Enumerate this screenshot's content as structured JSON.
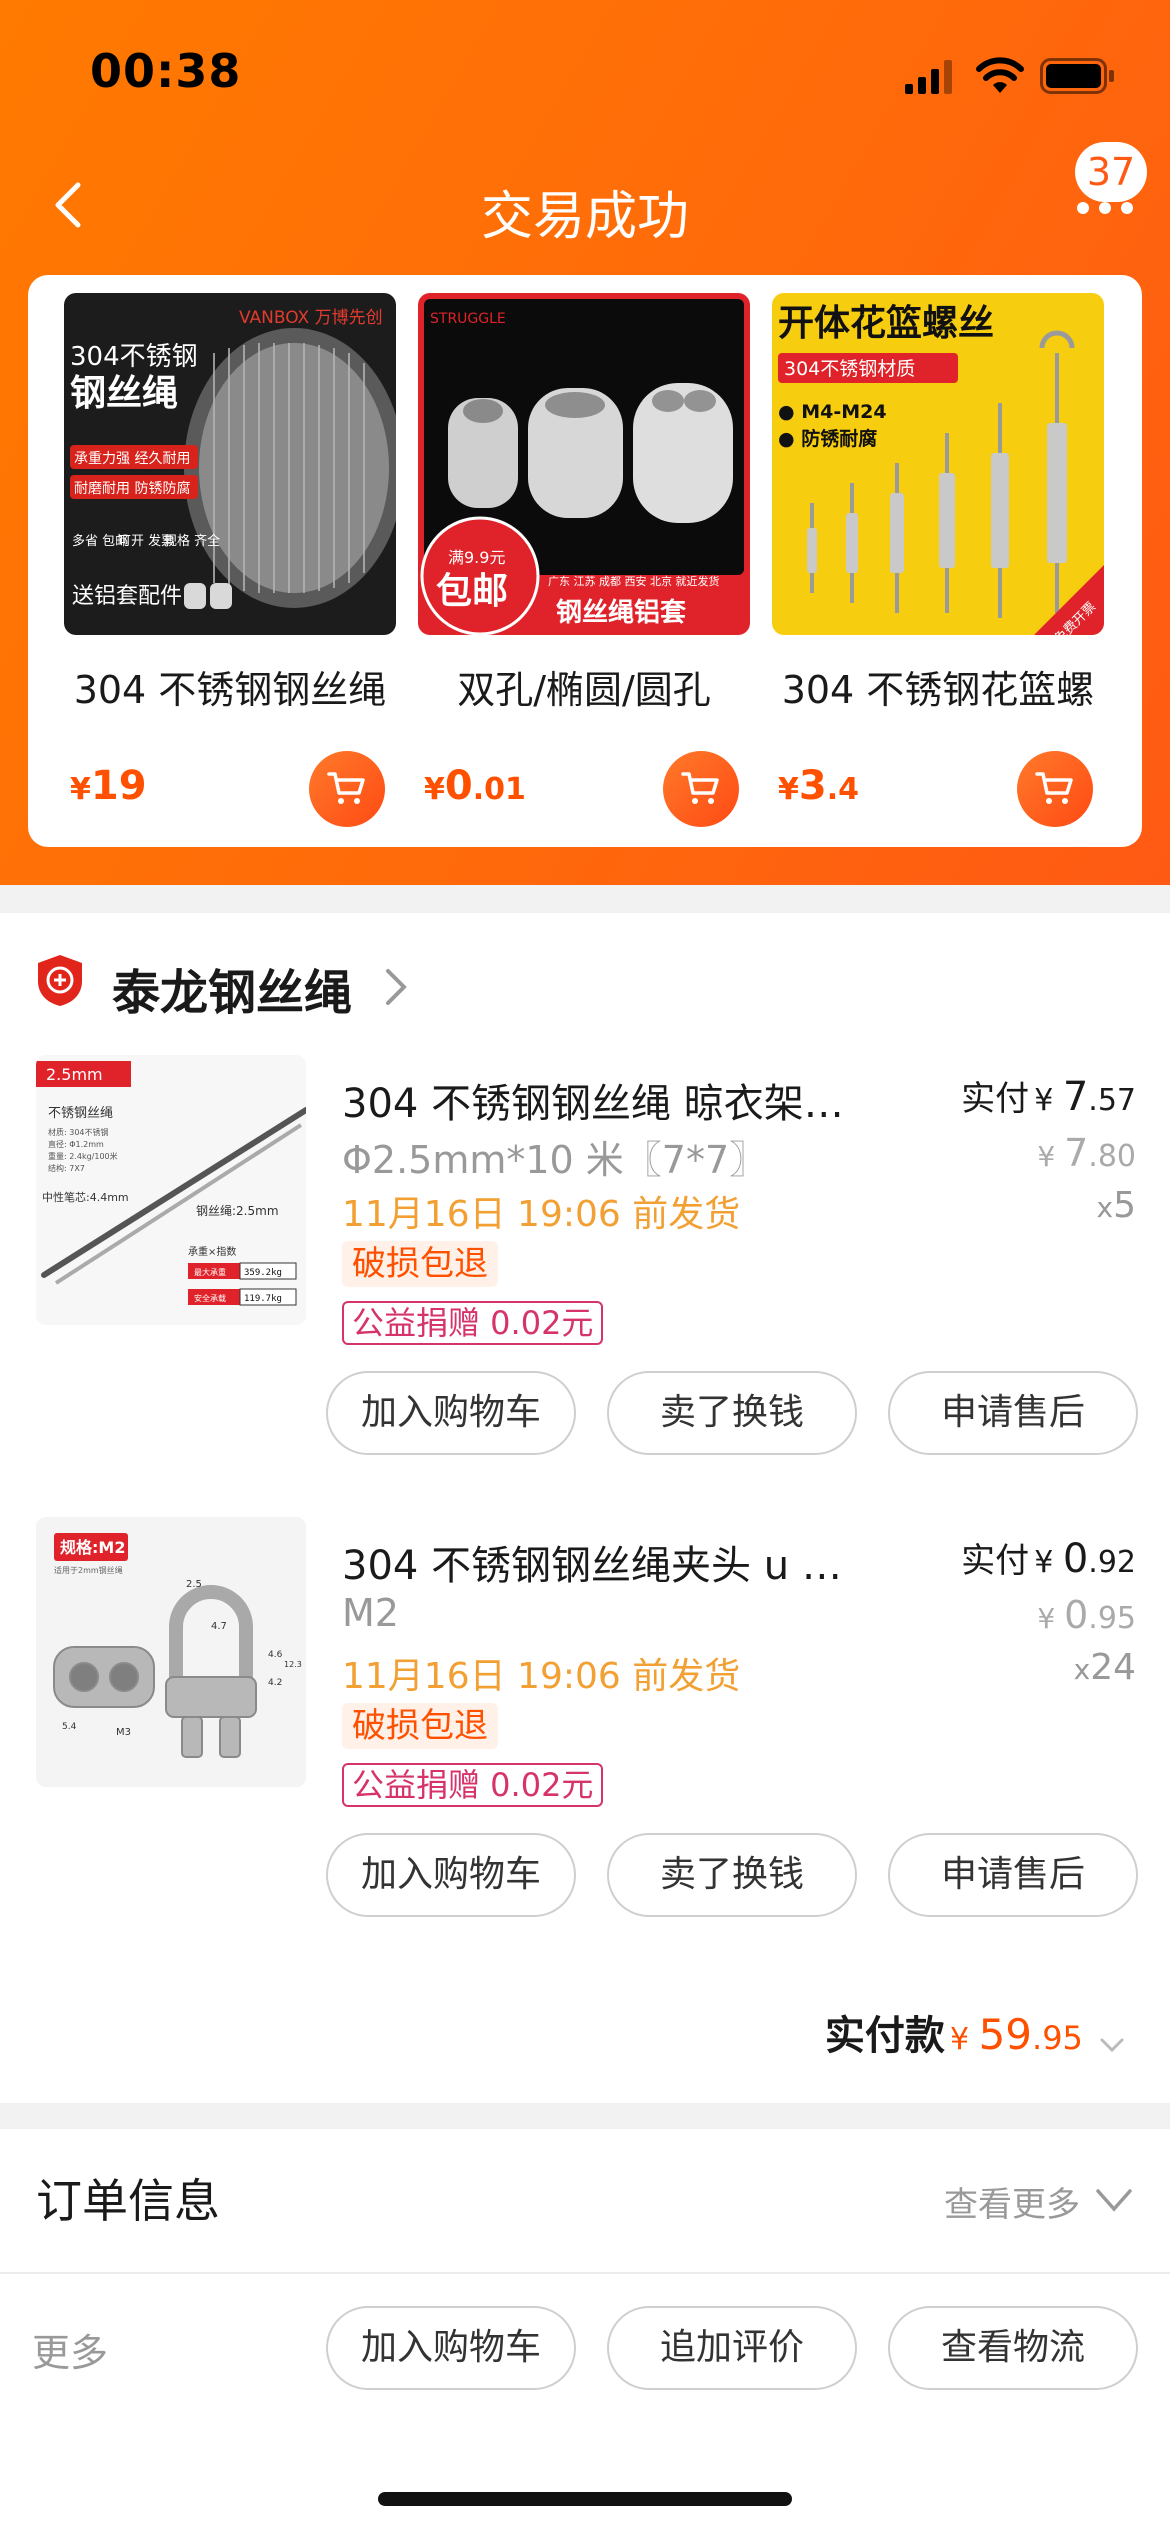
{
  "status_bar": {
    "time": "00:38"
  },
  "nav": {
    "title": "交易成功",
    "badge_count": "37"
  },
  "recommendations": [
    {
      "name": "304 不锈钢钢丝绳",
      "price_currency": "¥",
      "price_int": "19",
      "price_dec": "",
      "image_text": {
        "brand": "VANBOX 万博先创",
        "line1": "304不锈钢",
        "line2": "钢丝绳",
        "tag1": "承重力强 经久耐用",
        "tag2": "耐磨耐用 防锈防腐",
        "small1": "多省 包邮",
        "small2": "可开 发票",
        "small3": "规格 齐全",
        "bottom": "送铝套配件"
      }
    },
    {
      "name": "双孔/椭圆/圆孔",
      "price_currency": "¥",
      "price_int": "0",
      "price_dec": ".01",
      "image_text": {
        "brand": "STRUGGLE",
        "promo_top": "满9.9元",
        "promo_main": "包邮",
        "cities": "广东 江苏 成都 西安 北京 就近发货",
        "bottom": "钢丝绳铝套"
      }
    },
    {
      "name": "304 不锈钢花篮螺",
      "price_currency": "¥",
      "price_int": "3",
      "price_dec": ".4",
      "image_text": {
        "title": "开体花篮螺丝",
        "sub": "304不锈钢材质",
        "spec1": "● M4-M24",
        "spec2": "● 防锈耐腐",
        "corner": "免费开票"
      }
    }
  ],
  "shop": {
    "name": "泰龙钢丝绳"
  },
  "items": [
    {
      "title": "304 不锈钢钢丝绳 晾衣架…",
      "sku": "Φ2.5mm*10 米〖7*7〗",
      "ship": "11月16日 19:06 前发货",
      "tag": "破损包退",
      "charity": "公益捐赠 0.02元",
      "paid_label": "实付",
      "paid_currency": "¥ ",
      "paid_int": "7",
      "paid_dec": ".57",
      "orig_currency": "¥ ",
      "orig_int": "7",
      "orig_dec": ".80",
      "qty_x": "x",
      "qty_n": "5",
      "thumb_text": {
        "size": "2.5mm",
        "name": "不锈钢丝绳",
        "spec1": "材质: 304不锈钢",
        "spec2": "直径: Φ1.2mm",
        "spec3": "重量: 2.4kg/100米",
        "spec4": "结构: 7X7",
        "pen": "中性笔芯:4.4mm",
        "wire": "钢丝绳:2.5mm",
        "load": "承重×指数",
        "max_label": "最大承重",
        "max_val": "359.2kg",
        "safe_label": "安全承载",
        "safe_val": "119.7kg"
      },
      "buttons": [
        "加入购物车",
        "卖了换钱",
        "申请售后"
      ]
    },
    {
      "title": "304 不锈钢钢丝绳夹头 u 型…",
      "sku": "M2",
      "ship": "11月16日 19:06 前发货",
      "tag": "破损包退",
      "charity": "公益捐赠 0.02元",
      "paid_label": "实付",
      "paid_currency": "¥ ",
      "paid_int": "0",
      "paid_dec": ".92",
      "orig_currency": "¥ ",
      "orig_int": "0",
      "orig_dec": ".95",
      "qty_x": "x",
      "qty_n": "24",
      "thumb_text": {
        "spec": "规格:M2",
        "note": "适用于2mm钢丝绳",
        "d1": "2.5",
        "d2": "4.7",
        "d3": "4.6",
        "d4": "4.2",
        "d5": "12.3",
        "d6": "5.4",
        "d7": "M3"
      },
      "buttons": [
        "加入购物车",
        "卖了换钱",
        "申请售后"
      ]
    }
  ],
  "total": {
    "label": "实付款",
    "currency": "¥ ",
    "int": "59",
    "dec": ".95"
  },
  "order_info": {
    "title": "订单信息",
    "more": "查看更多"
  },
  "bottom_bar": {
    "more": "更多",
    "buttons": [
      "加入购物车",
      "追加评价",
      "查看物流"
    ]
  },
  "colors": {
    "brand_orange": "#ff6a0a",
    "price_orange": "#ff5000",
    "ship_amber": "#f2a033",
    "charity_pink": "#d6336c"
  },
  "icons": [
    "signal-icon",
    "wifi-icon",
    "battery-icon",
    "back-icon",
    "more-icon",
    "cart-icon",
    "shop-logo-icon",
    "chevron-right-icon",
    "chevron-down-icon"
  ]
}
